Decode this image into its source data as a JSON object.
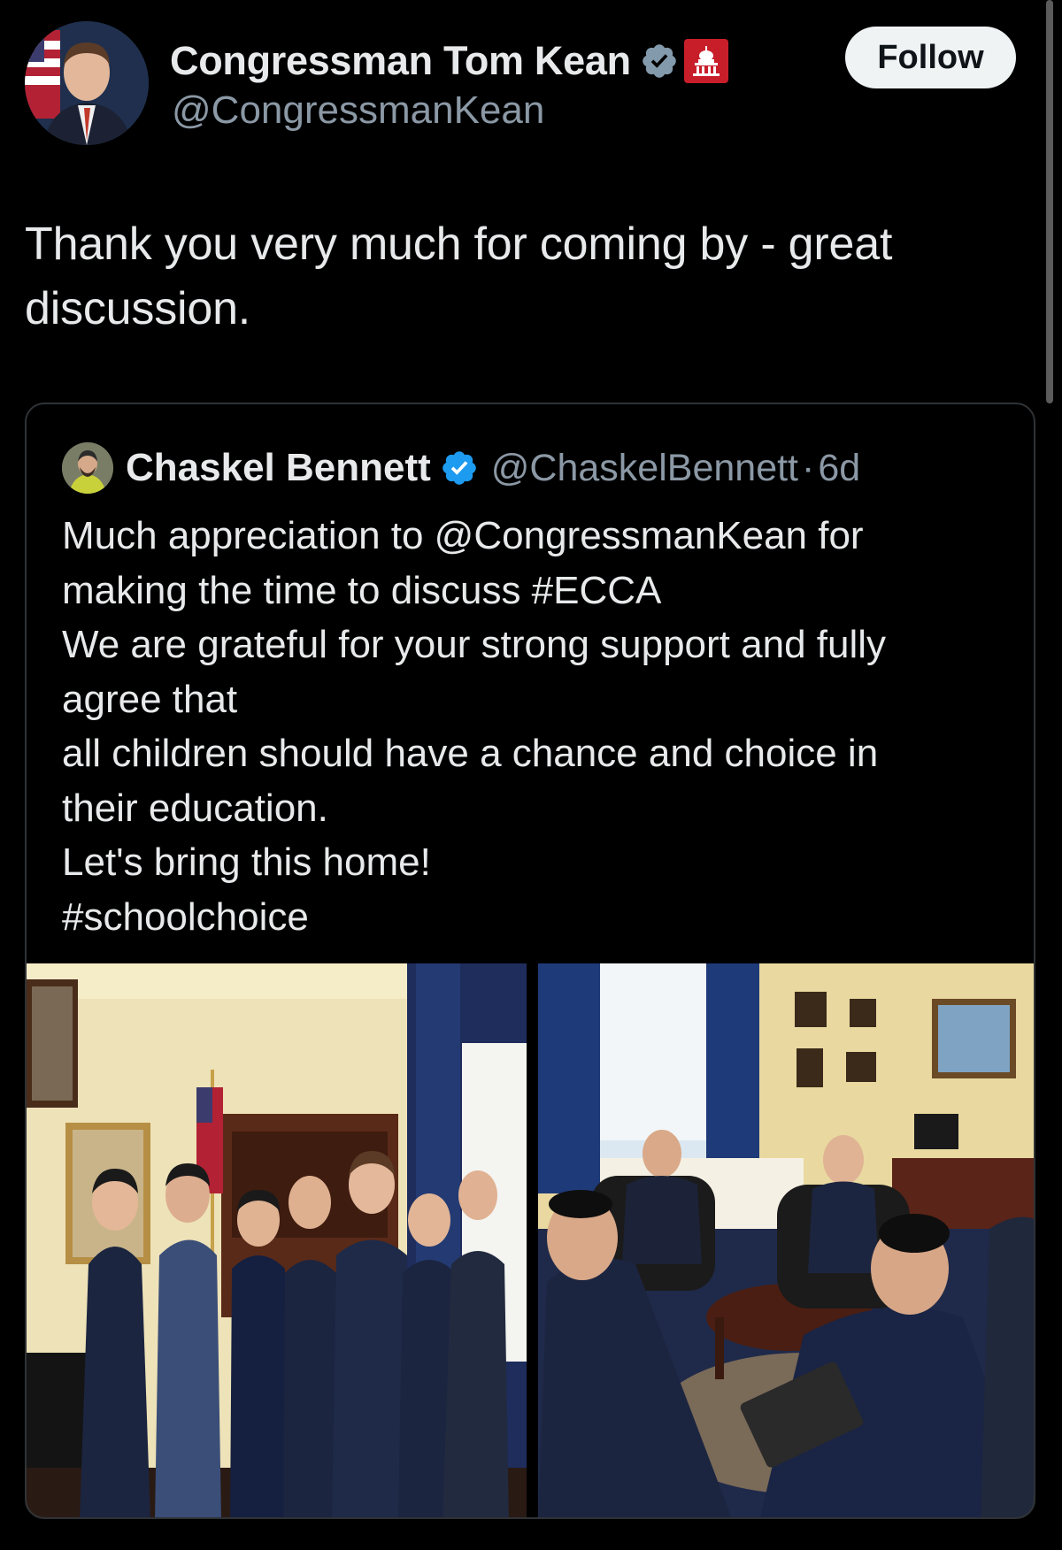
{
  "author": {
    "display_name": "Congressman Tom Kean",
    "handle": "@CongressmanKean",
    "verified_icon": "verified-badge-gray",
    "affiliate_badge": "us-capitol-badge",
    "follow_label": "Follow"
  },
  "tweet": {
    "text": "Thank you very much for coming by - great discussion."
  },
  "quoted_tweet": {
    "display_name": "Chaskel Bennett",
    "handle": "@ChaskelBennett",
    "separator": "·",
    "time": "6d",
    "verified_icon": "verified-badge-blue",
    "lines": [
      "Much appreciation to @CongressmanKean for",
      "making the time to discuss #ECCA",
      "We are grateful for your strong support and fully",
      "agree that",
      "all children should have a chance and choice in",
      "their education.",
      "Let's bring this home!",
      "#schoolchoice"
    ],
    "media": [
      {
        "type": "photo",
        "subject": "group-photo"
      },
      {
        "type": "photo",
        "subject": "office-meeting-photo"
      }
    ]
  },
  "colors": {
    "background": "#000000",
    "text_primary": "#e7e9ea",
    "text_secondary": "#8b98a5",
    "verified_blue": "#1d9bf0",
    "gov_badge_red": "#c81e2a",
    "card_border": "#2f3336",
    "follow_bg": "#eff3f4"
  }
}
